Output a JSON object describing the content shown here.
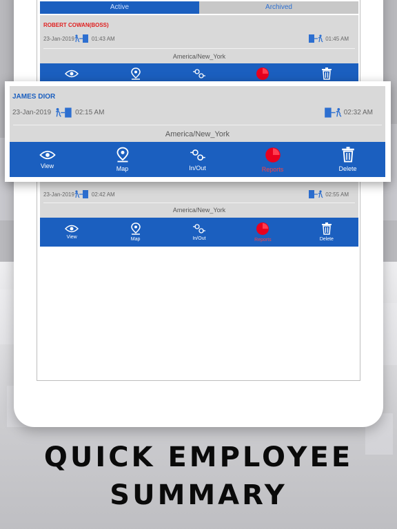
{
  "tabs": {
    "active": "Active",
    "archived": "Archived"
  },
  "records": [
    {
      "name": "ROBERT COWAN(BOSS)",
      "date": "23-Jan-2019",
      "in_time": "01:43 AM",
      "out_time": "01:45 AM",
      "timezone": "America/New_York"
    },
    {
      "name": "JAMES DIOR",
      "date": "23-Jan-2019",
      "in_time": "02:15 AM",
      "out_time": "02:32 AM",
      "timezone": "America/New_York"
    },
    {
      "name": "",
      "date": "23-Jan-2019",
      "in_time": "02:42 AM",
      "out_time": "02:55 AM",
      "timezone": "America/New_York"
    }
  ],
  "actions": {
    "view": "View",
    "map": "Map",
    "inout": "In/Out",
    "reports": "Reports",
    "delete": "Delete"
  },
  "headline": {
    "line1": "QUICK EMPLOYEE",
    "line2": "SUMMARY"
  },
  "colors": {
    "toolbar": "#1b5fbf",
    "boss_name": "#e02020",
    "reports_icon": "#e8001e",
    "tab_archived_text": "#2d6fd0"
  }
}
